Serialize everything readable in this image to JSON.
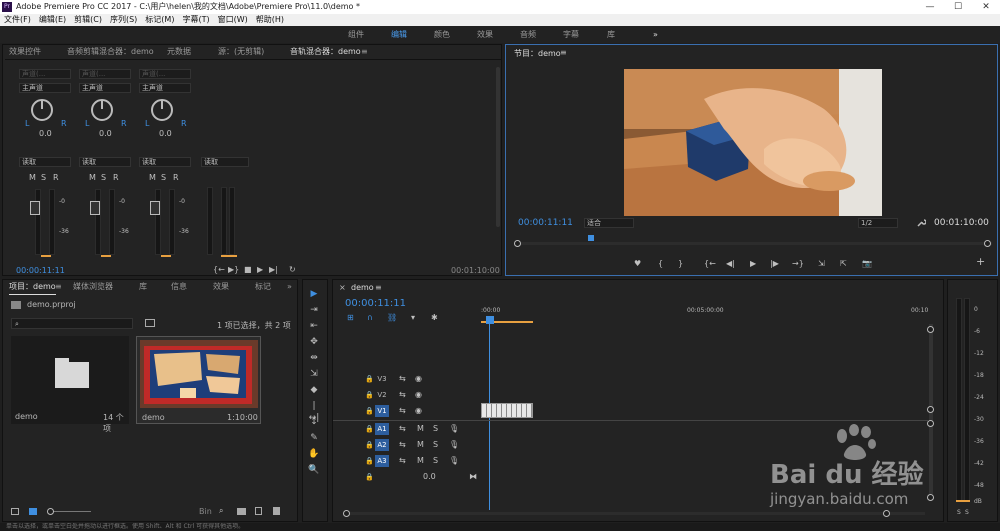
{
  "window": {
    "title": "Adobe Premiere Pro CC 2017 - C:\\用户\\helen\\我的文档\\Adobe\\Premiere Pro\\11.0\\demo *",
    "app_icon": "Pr",
    "minimize": "—",
    "maximize": "☐",
    "close": "✕"
  },
  "menu": [
    "文件(F)",
    "编辑(E)",
    "剪辑(C)",
    "序列(S)",
    "标记(M)",
    "字幕(T)",
    "窗口(W)",
    "帮助(H)"
  ],
  "workspaces": {
    "items": [
      "组件",
      "编辑",
      "颜色",
      "效果",
      "音频",
      "字幕",
      "库"
    ],
    "active": "编辑",
    "more": "»"
  },
  "source_panel": {
    "tabs": [
      "效果控件",
      "音频剪辑混合器：demo",
      "元数据",
      "源：(无剪辑)",
      "音轨混合器：demo"
    ],
    "active_tab": "音轨混合器：demo",
    "menu_icon": "≡",
    "channels": [
      {
        "top": "声道(...",
        "mode": "主声道",
        "pan": "0.0",
        "read": "读取",
        "L": "L",
        "R": "R"
      },
      {
        "top": "声道(...",
        "mode": "主声道",
        "pan": "0.0",
        "read": "读取",
        "L": "L",
        "R": "R"
      },
      {
        "top": "声道(...",
        "mode": "主声道",
        "pan": "0.0",
        "read": "读取",
        "L": "L",
        "R": "R"
      }
    ],
    "master_read": "读取",
    "msr": [
      "M",
      "S",
      "R"
    ],
    "db_scale": [
      "dB",
      "6",
      "0",
      "-6",
      "-12",
      "-18",
      "-24",
      "-36",
      "-48",
      "dB"
    ],
    "meter_scale": [
      "-0",
      "-36"
    ],
    "timecode_left": "00:00:11:11",
    "timecode_right": "00:01:10:00",
    "transport": [
      "{←",
      "▶}",
      "■",
      "▶",
      "▶|",
      "↻"
    ]
  },
  "program_panel": {
    "title": "节目：demo",
    "menu_icon": "≡",
    "timecode": "00:00:11:11",
    "fit": "适合",
    "resolution": "1/2",
    "duration": "00:01:10:00",
    "wrench_icon": "wrench-icon",
    "buttons": [
      "♥",
      "{",
      "}",
      "{←",
      "◀|",
      "▶",
      "|▶",
      "→}",
      "⇲",
      "⇱",
      "📷"
    ],
    "add": "+"
  },
  "project_panel": {
    "tabs": [
      "项目：demo",
      "媒体浏览器",
      "库",
      "信息",
      "效果",
      "标记"
    ],
    "active_tab": "项目：demo",
    "menu_icon": "≡",
    "more": "»",
    "file": "demo.prproj",
    "selection": "1 项已选择，共 2 项",
    "items": [
      {
        "name": "demo",
        "meta": "14 个项"
      },
      {
        "name": "demo",
        "meta": "1:10:00"
      }
    ],
    "footer_icons": [
      "list-icon",
      "grid-icon",
      "zoom-slider",
      "search-icon",
      "folder-icon",
      "new-item-icon",
      "trash-icon"
    ],
    "footer_label": "Bin"
  },
  "timeline_panel": {
    "title": "demo",
    "close": "×",
    "menu_icon": "≡",
    "timecode": "00:00:11:11",
    "ruler": [
      ":00:00",
      "00:05:00:00",
      "00:10"
    ],
    "video_tracks": [
      {
        "name": "V3",
        "label": "V3"
      },
      {
        "name": "V2",
        "label": "V2"
      },
      {
        "name": "V1",
        "label": "V1"
      }
    ],
    "audio_tracks": [
      {
        "name": "A1",
        "label": "A1"
      },
      {
        "name": "A2",
        "label": "A2"
      },
      {
        "name": "A3",
        "label": "A3"
      }
    ],
    "master_label": "0.0",
    "track_buttons": {
      "mute": "M",
      "solo": "S"
    },
    "clip_progress": 0.37
  },
  "tools": [
    "▶",
    "⇥",
    "⇤",
    "✥",
    "⇹",
    "⇲",
    "◆",
    "|↔|",
    "↕",
    "✎",
    "✋",
    "🔍"
  ],
  "audio_meter": {
    "scale": [
      "0",
      "-6",
      "-12",
      "-18",
      "-24",
      "-30",
      "-36",
      "-42",
      "-48",
      "dB"
    ],
    "buttons": [
      "S",
      "S"
    ]
  },
  "status_bar": "单击以选择，或单击空白处并拖动以进行框选。使用 Shift、Alt 和 Ctrl 可获得其他选项。",
  "watermark": {
    "brand": "Bai du 经验",
    "url": "jingyan.baidu.com"
  },
  "colors": {
    "accent": "#3f8fe0",
    "panel_bg": "#232323",
    "workspace_bg": "#222222",
    "clip_orange": "#e8a040"
  }
}
